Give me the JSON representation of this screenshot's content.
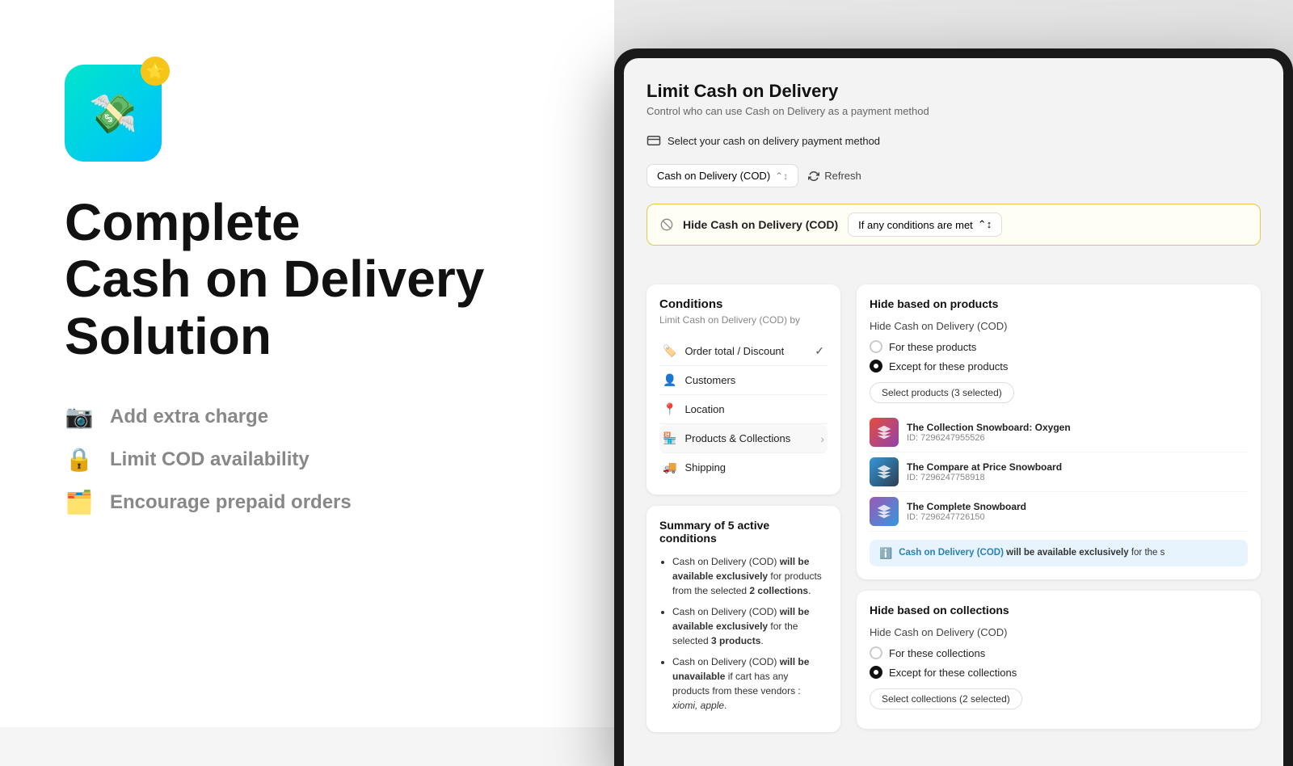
{
  "left": {
    "app_icon_emoji": "💸",
    "star": "⭐",
    "title_line1": "Complete",
    "title_line2": "Cash on Delivery",
    "title_line3": "Solution",
    "features": [
      {
        "icon": "📷",
        "text": "Add extra charge"
      },
      {
        "icon": "🔒",
        "text": "Limit COD availability"
      },
      {
        "icon": "🗂️",
        "text": "Encourage prepaid orders"
      }
    ]
  },
  "right": {
    "page_title": "Limit Cash on Delivery",
    "page_subtitle": "Control who can use Cash on Delivery as a payment method",
    "payment_section_label": "Select your cash on delivery payment method",
    "payment_select_value": "Cash on Delivery (COD)",
    "refresh_label": "Refresh",
    "cod_hide_label": "Hide Cash on Delivery (COD)",
    "conditions_dropdown": "If any conditions are met",
    "conditions_panel": {
      "title": "Conditions",
      "subtitle": "Limit Cash on Delivery (COD) by",
      "items": [
        {
          "icon": "🏷️",
          "label": "Order total / Discount",
          "has_check": true,
          "has_arrow": false
        },
        {
          "icon": "👤",
          "label": "Customers",
          "has_check": false,
          "has_arrow": false
        },
        {
          "icon": "📍",
          "label": "Location",
          "has_check": false,
          "has_arrow": false
        },
        {
          "icon": "🏪",
          "label": "Products & Collections",
          "has_check": false,
          "has_arrow": true
        },
        {
          "icon": "🚚",
          "label": "Shipping",
          "has_check": false,
          "has_arrow": false
        }
      ]
    },
    "summary": {
      "title": "Summary of 5 active conditions",
      "items": [
        "Cash on Delivery (COD) will be available exclusively for products from the selected 2 collections.",
        "Cash on Delivery (COD) will be available exclusively for the selected 3 products.",
        "Cash on Delivery (COD) will be unavailable if cart has any products from these vendors : xiomi, apple."
      ]
    },
    "products_panel": {
      "hide_title": "Hide based on products",
      "hide_subtitle": "Hide Cash on Delivery (COD)",
      "radio_option1": "For these products",
      "radio_option2": "Except for these products",
      "select_products_btn": "Select products (3 selected)",
      "products": [
        {
          "name": "The Collection Snowboard: Oxygen",
          "id": "ID: 7296247955526",
          "color": "red"
        },
        {
          "name": "The Compare at Price Snowboard",
          "id": "ID: 7296247758918",
          "color": "blue"
        },
        {
          "name": "The Complete Snowboard",
          "id": "ID: 7296247726150",
          "color": "purple"
        }
      ],
      "info_text_prefix": "Cash on Delivery (COD)",
      "info_text_bold": "will be available exclusively",
      "info_text_suffix": "for the s"
    },
    "collections_panel": {
      "title": "Hide based on collections",
      "subtitle": "Hide Cash on Delivery (COD)",
      "radio_option1": "For these collections",
      "radio_option2": "Except for these collections",
      "select_collections_btn": "Select collections (2 selected)"
    }
  }
}
